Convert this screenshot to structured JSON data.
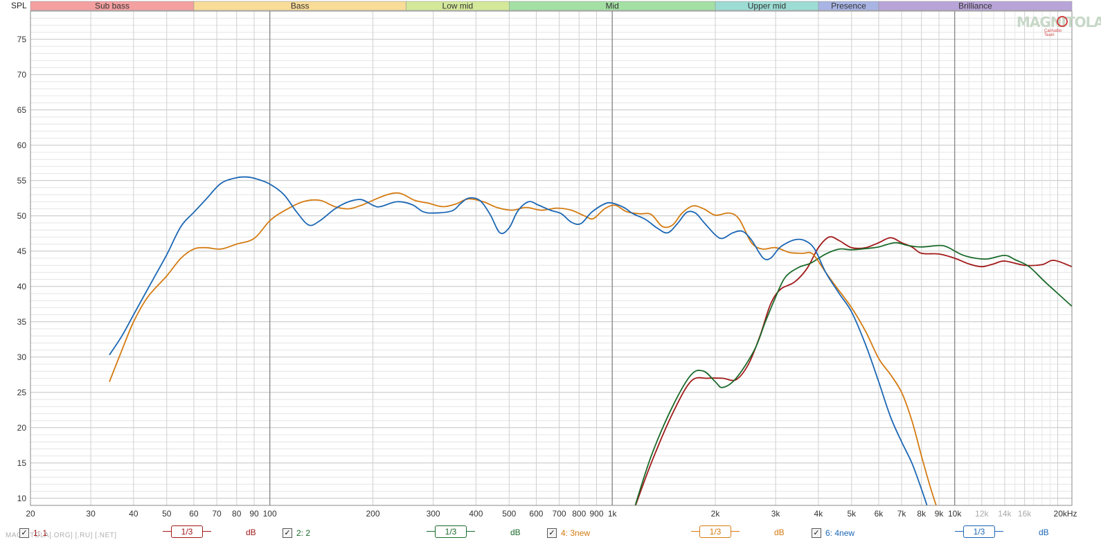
{
  "chart_data": {
    "type": "line",
    "ylabel": "SPL",
    "ylim": [
      9,
      79
    ],
    "xlim": [
      20,
      22000
    ],
    "x_scale": "log",
    "y_ticks": [
      10,
      15,
      20,
      25,
      30,
      35,
      40,
      45,
      50,
      55,
      60,
      65,
      70,
      75
    ],
    "x_ticks": [
      {
        "v": 20,
        "label": "20",
        "major": false
      },
      {
        "v": 30,
        "label": "30",
        "major": false
      },
      {
        "v": 40,
        "label": "40",
        "major": false
      },
      {
        "v": 50,
        "label": "50",
        "major": false
      },
      {
        "v": 60,
        "label": "60",
        "major": false
      },
      {
        "v": 70,
        "label": "70",
        "major": false
      },
      {
        "v": 80,
        "label": "80",
        "major": false
      },
      {
        "v": 90,
        "label": "90",
        "major": false
      },
      {
        "v": 100,
        "label": "100",
        "major": true
      },
      {
        "v": 200,
        "label": "200",
        "major": false
      },
      {
        "v": 300,
        "label": "300",
        "major": false
      },
      {
        "v": 400,
        "label": "400",
        "major": false
      },
      {
        "v": 500,
        "label": "500",
        "major": false
      },
      {
        "v": 600,
        "label": "600",
        "major": false
      },
      {
        "v": 700,
        "label": "700",
        "major": false
      },
      {
        "v": 800,
        "label": "800",
        "major": false
      },
      {
        "v": 900,
        "label": "900",
        "major": false
      },
      {
        "v": 1000,
        "label": "1k",
        "major": true
      },
      {
        "v": 2000,
        "label": "2k",
        "major": false
      },
      {
        "v": 3000,
        "label": "3k",
        "major": false
      },
      {
        "v": 4000,
        "label": "4k",
        "major": false
      },
      {
        "v": 5000,
        "label": "5k",
        "major": false
      },
      {
        "v": 6000,
        "label": "6k",
        "major": false
      },
      {
        "v": 7000,
        "label": "7k",
        "major": false
      },
      {
        "v": 8000,
        "label": "8k",
        "major": false
      },
      {
        "v": 9000,
        "label": "9k",
        "major": false
      },
      {
        "v": 10000,
        "label": "10k",
        "major": true
      },
      {
        "v": 12000,
        "label": "12k",
        "major": false,
        "faint": true
      },
      {
        "v": 14000,
        "label": "14k",
        "major": false,
        "faint": true
      },
      {
        "v": 16000,
        "label": "16k",
        "major": false,
        "faint": true
      },
      {
        "v": 20000,
        "label": "20kHz",
        "major": false
      }
    ],
    "bands": [
      {
        "name": "Sub bass",
        "from": 20,
        "to": 60,
        "color": "#f4a0a0"
      },
      {
        "name": "Bass",
        "from": 60,
        "to": 250,
        "color": "#f8dc98"
      },
      {
        "name": "Low mid",
        "from": 250,
        "to": 500,
        "color": "#d4e89a"
      },
      {
        "name": "Mid",
        "from": 500,
        "to": 2000,
        "color": "#a4e0a4"
      },
      {
        "name": "Upper mid",
        "from": 2000,
        "to": 4000,
        "color": "#9cdcd4"
      },
      {
        "name": "Presence",
        "from": 4000,
        "to": 6000,
        "color": "#a8b4e4"
      },
      {
        "name": "Brilliance",
        "from": 6000,
        "to": 22000,
        "color": "#b8a4d8"
      }
    ],
    "series": [
      {
        "name": "1: 1",
        "color": "#a01818",
        "points": [
          [
            1150,
            8
          ],
          [
            1300,
            15
          ],
          [
            1500,
            22
          ],
          [
            1700,
            26.6
          ],
          [
            1900,
            27
          ],
          [
            2100,
            27
          ],
          [
            2300,
            26.8
          ],
          [
            2500,
            29
          ],
          [
            2700,
            33
          ],
          [
            2900,
            37.5
          ],
          [
            3100,
            39.6
          ],
          [
            3400,
            40.6
          ],
          [
            3700,
            42.5
          ],
          [
            4000,
            45.5
          ],
          [
            4300,
            47
          ],
          [
            4600,
            46.5
          ],
          [
            5000,
            45.5
          ],
          [
            5500,
            45.5
          ],
          [
            6000,
            46.2
          ],
          [
            6500,
            46.9
          ],
          [
            7000,
            46.2
          ],
          [
            7500,
            45.6
          ],
          [
            8000,
            44.7
          ],
          [
            9000,
            44.6
          ],
          [
            10000,
            44
          ],
          [
            11000,
            43.2
          ],
          [
            12000,
            42.8
          ],
          [
            13000,
            43.2
          ],
          [
            14000,
            43.6
          ],
          [
            16000,
            43
          ],
          [
            18000,
            43.1
          ],
          [
            19500,
            43.7
          ],
          [
            22000,
            42.8
          ]
        ]
      },
      {
        "name": "2: 2",
        "color": "#1a6a2a",
        "points": [
          [
            1150,
            8
          ],
          [
            1300,
            16
          ],
          [
            1500,
            23
          ],
          [
            1700,
            27.5
          ],
          [
            1850,
            28
          ],
          [
            2000,
            26.5
          ],
          [
            2100,
            25.7
          ],
          [
            2300,
            27
          ],
          [
            2600,
            31
          ],
          [
            2800,
            35
          ],
          [
            3000,
            38.5
          ],
          [
            3200,
            41.3
          ],
          [
            3500,
            42.7
          ],
          [
            3800,
            43.3
          ],
          [
            4200,
            44.6
          ],
          [
            4600,
            45.3
          ],
          [
            5000,
            45.2
          ],
          [
            5600,
            45.4
          ],
          [
            6000,
            45.6
          ],
          [
            6700,
            46.2
          ],
          [
            7300,
            45.8
          ],
          [
            8000,
            45.6
          ],
          [
            9000,
            45.8
          ],
          [
            9500,
            45.6
          ],
          [
            10500,
            44.5
          ],
          [
            11500,
            44
          ],
          [
            12500,
            43.9
          ],
          [
            14000,
            44.4
          ],
          [
            15000,
            43.8
          ],
          [
            16500,
            42.8
          ],
          [
            18500,
            40.5
          ],
          [
            22000,
            37.2
          ]
        ]
      },
      {
        "name": "4: 3new",
        "color": "#d47a10",
        "points": [
          [
            34,
            26.5
          ],
          [
            37,
            31
          ],
          [
            40,
            35
          ],
          [
            44,
            38.5
          ],
          [
            50,
            41.5
          ],
          [
            55,
            44
          ],
          [
            60,
            45.3
          ],
          [
            65,
            45.5
          ],
          [
            72,
            45.3
          ],
          [
            80,
            46
          ],
          [
            90,
            46.8
          ],
          [
            100,
            49.3
          ],
          [
            110,
            50.7
          ],
          [
            125,
            52
          ],
          [
            140,
            52.2
          ],
          [
            155,
            51.3
          ],
          [
            170,
            51
          ],
          [
            185,
            51.5
          ],
          [
            200,
            52.2
          ],
          [
            220,
            53
          ],
          [
            240,
            53.2
          ],
          [
            265,
            52.2
          ],
          [
            290,
            51.8
          ],
          [
            320,
            51.3
          ],
          [
            350,
            51.7
          ],
          [
            380,
            52.4
          ],
          [
            420,
            52
          ],
          [
            460,
            51.2
          ],
          [
            510,
            50.8
          ],
          [
            560,
            51.2
          ],
          [
            620,
            50.8
          ],
          [
            690,
            51.1
          ],
          [
            760,
            50.8
          ],
          [
            830,
            50
          ],
          [
            880,
            49.6
          ],
          [
            950,
            51
          ],
          [
            1020,
            51.5
          ],
          [
            1100,
            50.6
          ],
          [
            1200,
            50.3
          ],
          [
            1300,
            50.2
          ],
          [
            1400,
            48.5
          ],
          [
            1500,
            48.7
          ],
          [
            1600,
            50.4
          ],
          [
            1720,
            51.4
          ],
          [
            1850,
            51
          ],
          [
            2000,
            50.1
          ],
          [
            2200,
            50.4
          ],
          [
            2350,
            49.5
          ],
          [
            2550,
            46.2
          ],
          [
            2750,
            45.3
          ],
          [
            3000,
            45.5
          ],
          [
            3300,
            44.8
          ],
          [
            3600,
            44.7
          ],
          [
            3850,
            44.6
          ],
          [
            4200,
            42
          ],
          [
            4500,
            40
          ],
          [
            5000,
            37
          ],
          [
            5500,
            33.6
          ],
          [
            6000,
            29.8
          ],
          [
            6500,
            27.5
          ],
          [
            7000,
            25
          ],
          [
            7500,
            21
          ],
          [
            8000,
            16
          ],
          [
            8500,
            11.5
          ],
          [
            8900,
            8.5
          ]
        ]
      },
      {
        "name": "6: 4new",
        "color": "#1a66b4",
        "points": [
          [
            34,
            30.3
          ],
          [
            37,
            33
          ],
          [
            40,
            36
          ],
          [
            45,
            40.5
          ],
          [
            50,
            44.5
          ],
          [
            55,
            48.5
          ],
          [
            60,
            50.5
          ],
          [
            65,
            52.3
          ],
          [
            72,
            54.6
          ],
          [
            80,
            55.4
          ],
          [
            86,
            55.5
          ],
          [
            92,
            55.2
          ],
          [
            100,
            54.5
          ],
          [
            110,
            53
          ],
          [
            120,
            50.5
          ],
          [
            130,
            48.7
          ],
          [
            140,
            49.3
          ],
          [
            155,
            51
          ],
          [
            170,
            52
          ],
          [
            185,
            52.3
          ],
          [
            200,
            51.5
          ],
          [
            210,
            51.3
          ],
          [
            235,
            52
          ],
          [
            260,
            51.6
          ],
          [
            280,
            50.6
          ],
          [
            300,
            50.4
          ],
          [
            340,
            50.7
          ],
          [
            360,
            51.7
          ],
          [
            380,
            52.5
          ],
          [
            410,
            52.2
          ],
          [
            440,
            50.2
          ],
          [
            470,
            47.6
          ],
          [
            500,
            48.3
          ],
          [
            530,
            50.7
          ],
          [
            570,
            52
          ],
          [
            610,
            51.5
          ],
          [
            660,
            50.8
          ],
          [
            710,
            50.3
          ],
          [
            760,
            49.1
          ],
          [
            810,
            48.9
          ],
          [
            870,
            50.5
          ],
          [
            950,
            51.7
          ],
          [
            1000,
            51.8
          ],
          [
            1080,
            51.2
          ],
          [
            1150,
            50.3
          ],
          [
            1250,
            49.5
          ],
          [
            1350,
            48.3
          ],
          [
            1450,
            47.6
          ],
          [
            1550,
            48.9
          ],
          [
            1650,
            50.5
          ],
          [
            1750,
            50.4
          ],
          [
            1850,
            49.1
          ],
          [
            2000,
            47.3
          ],
          [
            2100,
            46.8
          ],
          [
            2250,
            47.6
          ],
          [
            2400,
            47.8
          ],
          [
            2550,
            46.6
          ],
          [
            2750,
            44.1
          ],
          [
            2900,
            44
          ],
          [
            3100,
            45.6
          ],
          [
            3400,
            46.6
          ],
          [
            3650,
            46.5
          ],
          [
            3900,
            45.3
          ],
          [
            4200,
            42
          ],
          [
            4600,
            39
          ],
          [
            5000,
            36.4
          ],
          [
            5500,
            31.7
          ],
          [
            6000,
            26.5
          ],
          [
            6500,
            21.5
          ],
          [
            7000,
            18
          ],
          [
            7500,
            15
          ],
          [
            8000,
            11.3
          ],
          [
            8300,
            9
          ]
        ]
      }
    ]
  },
  "legend": [
    {
      "check": "✓",
      "name": "1: 1",
      "smoothing": "1/3",
      "unit": "dB",
      "color": "#a01818"
    },
    {
      "check": "✓",
      "name": "2: 2",
      "smoothing": "1/3",
      "unit": "dB",
      "color": "#1a6a2a"
    },
    {
      "check": "✓",
      "name": "4: 3new",
      "smoothing": "1/3",
      "unit": "dB",
      "color": "#d47a10"
    },
    {
      "check": "✓",
      "name": "6: 4new",
      "smoothing": "1/3",
      "unit": "dB",
      "color": "#1a66b4"
    }
  ],
  "watermark": "MAGNITOLA[.ORG] [.RU] [.NET]",
  "logo": {
    "text": "MAGNITOLA",
    "subtext": "CarAudio Team"
  }
}
